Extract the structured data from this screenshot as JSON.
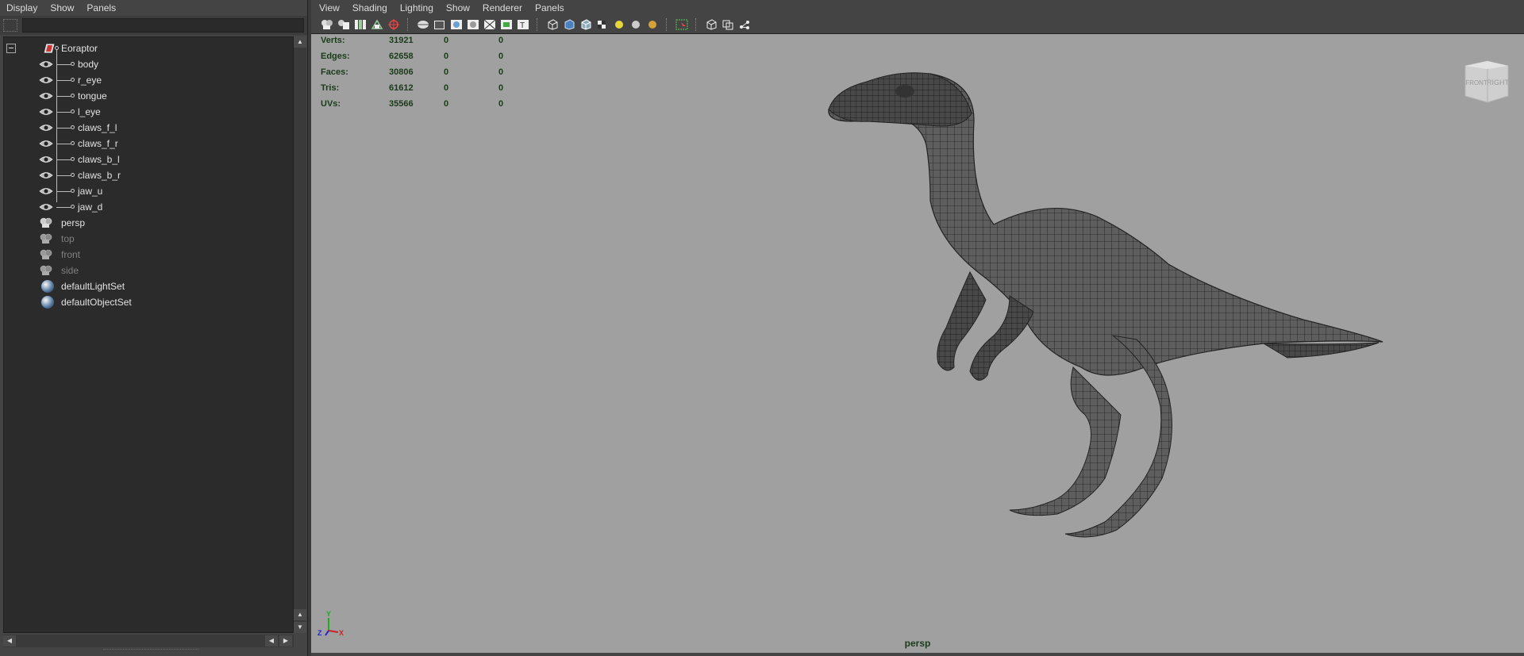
{
  "outliner": {
    "menu": [
      "Display",
      "Show",
      "Panels"
    ],
    "search_value": "",
    "items": [
      {
        "label": "Eoraptor",
        "dim": false
      },
      {
        "label": "body",
        "dim": false
      },
      {
        "label": "r_eye",
        "dim": false
      },
      {
        "label": "tongue",
        "dim": false
      },
      {
        "label": "l_eye",
        "dim": false
      },
      {
        "label": "claws_f_l",
        "dim": false
      },
      {
        "label": "claws_f_r",
        "dim": false
      },
      {
        "label": "claws_b_l",
        "dim": false
      },
      {
        "label": "claws_b_r",
        "dim": false
      },
      {
        "label": "jaw_u",
        "dim": false
      },
      {
        "label": "jaw_d",
        "dim": false
      },
      {
        "label": "persp",
        "dim": false
      },
      {
        "label": "top",
        "dim": true
      },
      {
        "label": "front",
        "dim": true
      },
      {
        "label": "side",
        "dim": true
      },
      {
        "label": "defaultLightSet",
        "dim": false
      },
      {
        "label": "defaultObjectSet",
        "dim": false
      }
    ]
  },
  "viewport": {
    "menu": [
      "View",
      "Shading",
      "Lighting",
      "Show",
      "Renderer",
      "Panels"
    ],
    "camera": "persp",
    "viewcube": {
      "left": "FRONT",
      "right": "RIGHT"
    },
    "axis": {
      "y": "Y",
      "z": "Z",
      "x": "X"
    },
    "hud": [
      {
        "label": "Verts:",
        "v1": "31921",
        "v2": "0",
        "v3": "0"
      },
      {
        "label": "Edges:",
        "v1": "62658",
        "v2": "0",
        "v3": "0"
      },
      {
        "label": "Faces:",
        "v1": "30806",
        "v2": "0",
        "v3": "0"
      },
      {
        "label": "Tris:",
        "v1": "61612",
        "v2": "0",
        "v3": "0"
      },
      {
        "label": "UVs:",
        "v1": "35566",
        "v2": "0",
        "v3": "0"
      }
    ]
  },
  "colors": {
    "viewport_bg": "#a0a0a0",
    "hud_text": "#1a3b1a",
    "mesh_fill": "#5a5a5a",
    "mesh_wire": "#1c1c1c"
  }
}
